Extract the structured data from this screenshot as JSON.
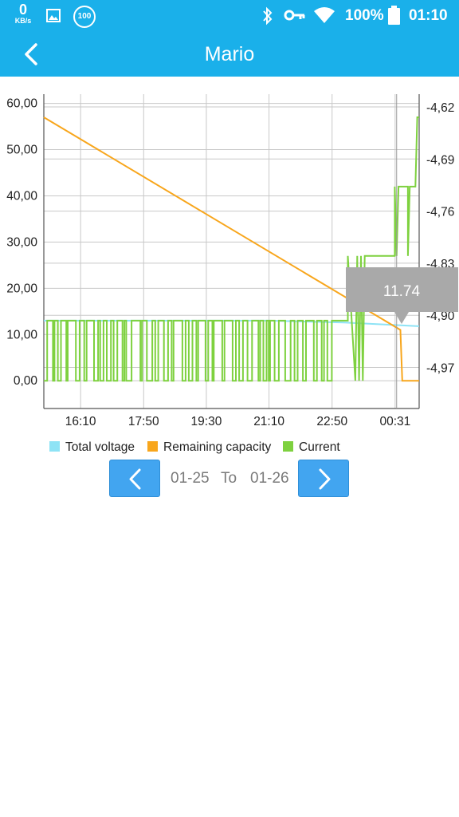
{
  "status_bar": {
    "net_speed_value": "0",
    "net_speed_unit": "KB/s",
    "badge": "100",
    "battery_percent": "100%",
    "time": "01:10"
  },
  "app_bar": {
    "title": "Mario"
  },
  "chart_data": {
    "type": "line",
    "x_tick_labels": [
      "16:10",
      "17:50",
      "19:30",
      "21:10",
      "22:50",
      "00:31"
    ],
    "y_left_tick_labels": [
      "60,00",
      "50,00",
      "40,00",
      "30,00",
      "20,00",
      "10,00",
      "0,00"
    ],
    "y_left_ticks": [
      60,
      50,
      40,
      30,
      20,
      10,
      0
    ],
    "ylim_left": [
      -6,
      62
    ],
    "y_right_tick_labels": [
      "-4,62",
      "-4,69",
      "-4,76",
      "-4,83",
      "-4,90",
      "-4,97"
    ],
    "ylim_right": [
      -5.01,
      -4.6
    ],
    "grid": true,
    "legend_position": "bottom",
    "tooltip": "11.74",
    "series": [
      {
        "name": "Total voltage",
        "color": "#8ee3f5",
        "values": [
          13,
          13,
          13,
          13,
          12.5,
          11.8
        ]
      },
      {
        "name": "Remaining capacity",
        "color": "#f8a61c",
        "values": [
          57,
          48,
          39,
          30,
          21,
          11,
          0
        ]
      },
      {
        "name": "Current",
        "color": "#7ed13f",
        "values": [
          0,
          13,
          0,
          13,
          0,
          13,
          27,
          42,
          57
        ]
      }
    ]
  },
  "date_nav": {
    "from": "01-25",
    "to_label": "To",
    "to": "01-26"
  }
}
